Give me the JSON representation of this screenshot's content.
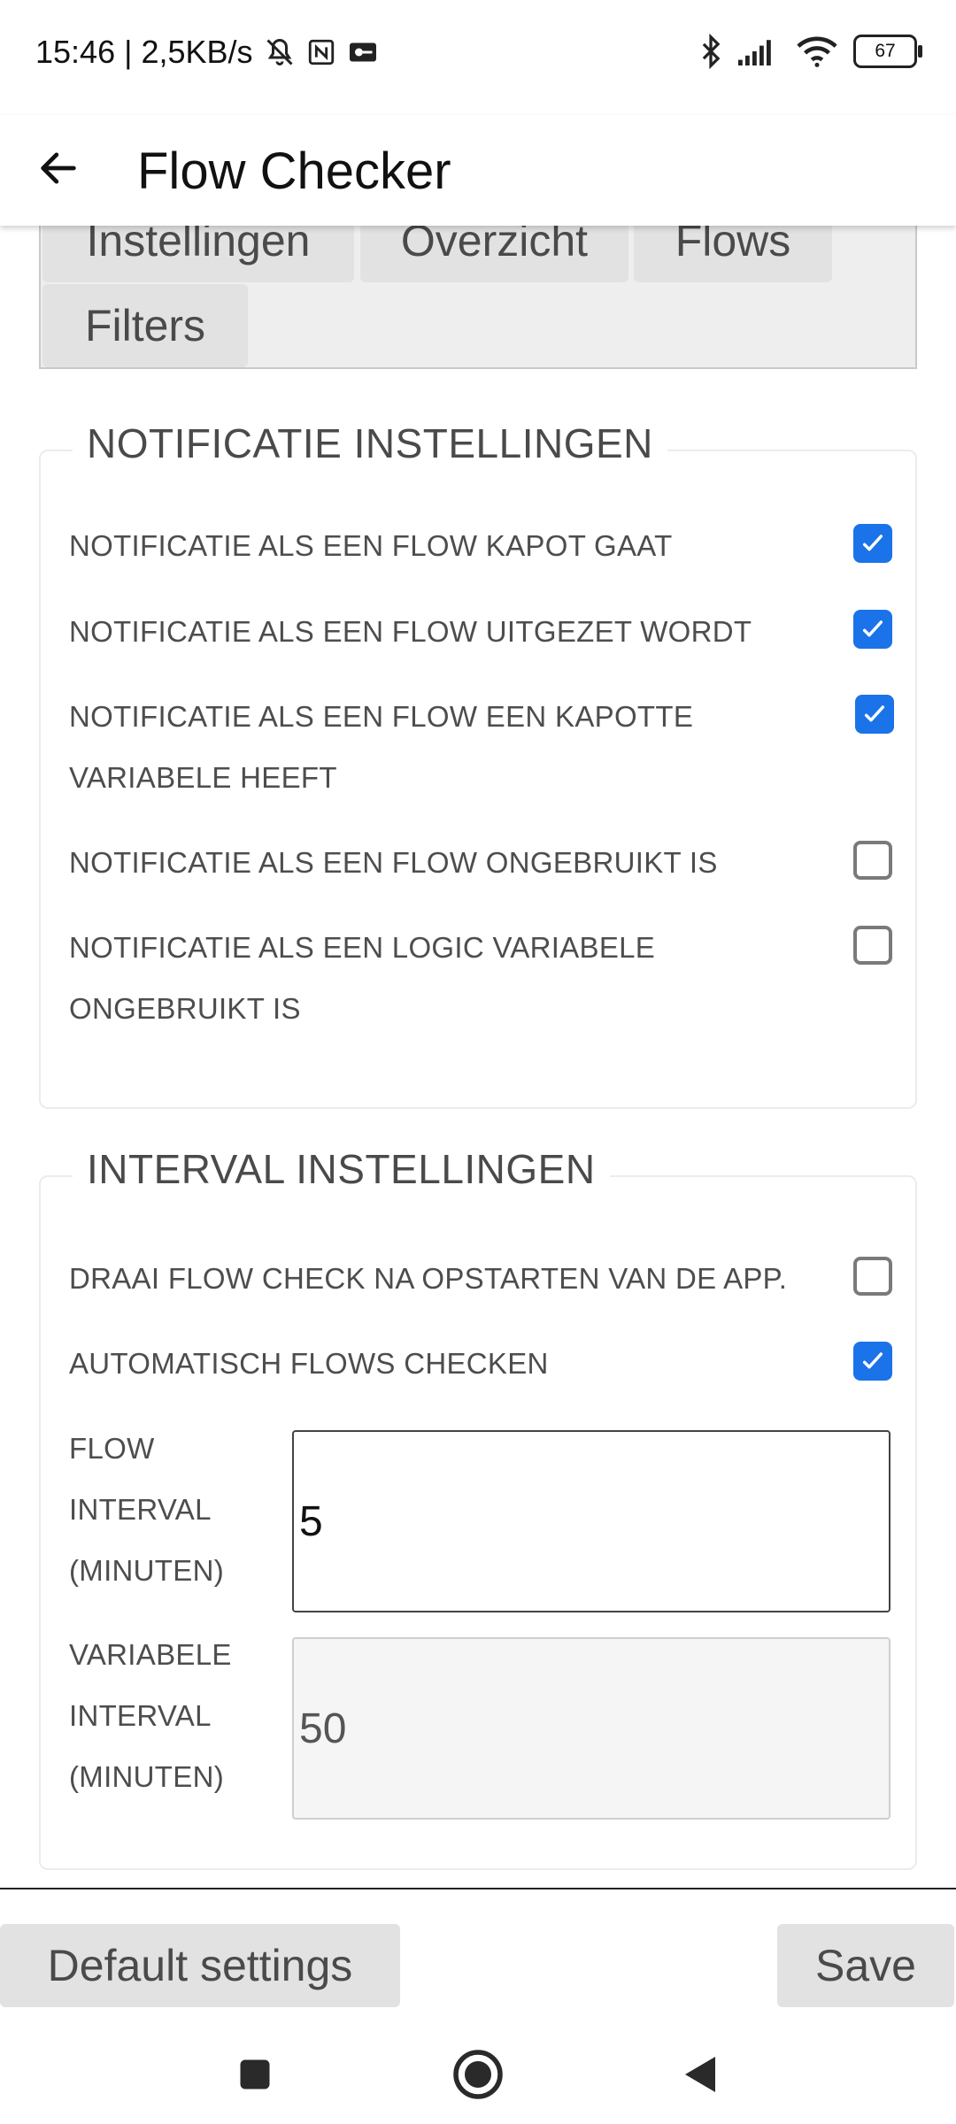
{
  "status_bar": {
    "time_speed": "15:46 | 2,5KB/s",
    "battery": "67"
  },
  "app_bar": {
    "title": "Flow Checker"
  },
  "tabs": [
    {
      "label": "Instellingen"
    },
    {
      "label": "Overzicht"
    },
    {
      "label": "Flows"
    },
    {
      "label": "Filters"
    }
  ],
  "notification_settings": {
    "legend": "NOTIFICATIE INSTELLINGEN",
    "options": [
      {
        "label": "NOTIFICATIE ALS EEN FLOW KAPOT GAAT",
        "checked": true
      },
      {
        "label": "NOTIFICATIE ALS EEN FLOW UITGEZET WORDT",
        "checked": true
      },
      {
        "label": "NOTIFICATIE ALS EEN FLOW EEN KAPOTTE VARIABELE HEEFT",
        "checked": true
      },
      {
        "label": "NOTIFICATIE ALS EEN FLOW ONGEBRUIKT IS",
        "checked": false
      },
      {
        "label": "NOTIFICATIE ALS EEN LOGIC VARIABELE ONGEBRUIKT IS",
        "checked": false
      }
    ]
  },
  "interval_settings": {
    "legend": "INTERVAL INSTELLINGEN",
    "options": [
      {
        "label": "DRAAI FLOW CHECK NA OPSTARTEN VAN DE APP.",
        "checked": false
      },
      {
        "label": "AUTOMATISCH FLOWS CHECKEN",
        "checked": true
      }
    ],
    "flow_interval": {
      "label": "FLOW INTERVAL (MINUTEN)",
      "value": "5"
    },
    "variable_interval": {
      "label": "VARIABELE INTERVAL (MINUTEN)",
      "value": "50"
    }
  },
  "buttons": {
    "default_settings": "Default settings",
    "save": "Save"
  },
  "colors": {
    "accent": "#1a73e8",
    "tab_bg": "#e2e2e2"
  }
}
